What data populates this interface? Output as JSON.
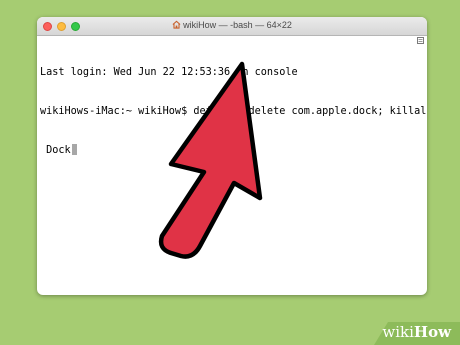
{
  "window": {
    "title": "wikiHow — -bash — 64×22"
  },
  "terminal": {
    "lines": [
      "Last login: Wed Jun 22 12:53:36 on console",
      "wikiHows-iMac:~ wikiHow$ defaults delete com.apple.dock; killall",
      " Dock"
    ]
  },
  "watermark": {
    "wiki": "wiki",
    "how": "How"
  },
  "colors": {
    "background": "#a6cc72",
    "arrow_fill": "#e03346",
    "arrow_stroke": "#000000"
  },
  "icons": {
    "title": "home-folder-icon",
    "scroll": "scroll-indicator-icon",
    "pointer": "red-arrow-pointer-icon"
  }
}
